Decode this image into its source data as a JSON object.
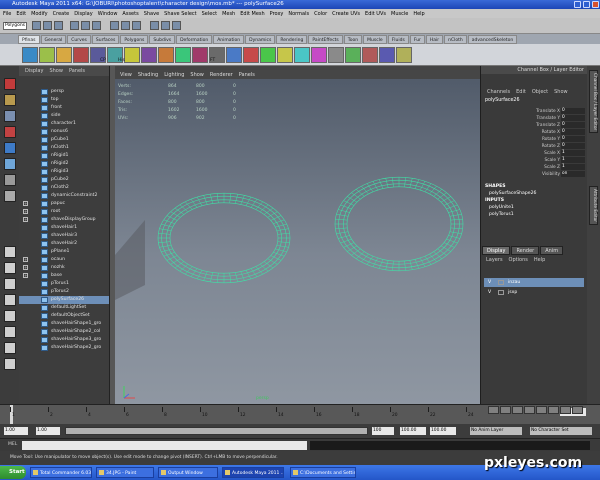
{
  "window": {
    "title": "Autodesk Maya 2011 x64: G:\\JOBURI\\photoshoptalent\\character design\\mos.mb* --- polySurface26"
  },
  "menubar": [
    "File",
    "Edit",
    "Modify",
    "Create",
    "Display",
    "Window",
    "Assets",
    "Shave",
    "Shave Select",
    "Select",
    "Mesh",
    "Edit Mesh",
    "Proxy",
    "Normals",
    "Color",
    "Create UVs",
    "Edit UVs",
    "Muscle",
    "Help"
  ],
  "statusline": {
    "mode": "Polygons"
  },
  "shelf_tabs": [
    "Pfinas",
    "General",
    "Curves",
    "Surfaces",
    "Polygons",
    "Subdivs",
    "Deformation",
    "Animation",
    "Dynamics",
    "Rendering",
    "PaintEffects",
    "Toon",
    "Muscle",
    "Fluids",
    "Fur",
    "Hair",
    "nCloth",
    "advancedSkeleton"
  ],
  "shelf_labels": [
    "CP",
    "His",
    "FT"
  ],
  "outliner": {
    "menu": [
      "Display",
      "Show",
      "Panels"
    ],
    "items": [
      {
        "label": "persp",
        "expandable": false,
        "selected": false
      },
      {
        "label": "top",
        "expandable": false,
        "selected": false
      },
      {
        "label": "front",
        "expandable": false,
        "selected": false
      },
      {
        "label": "side",
        "expandable": false,
        "selected": false
      },
      {
        "label": "character1",
        "expandable": false,
        "selected": false
      },
      {
        "label": "nonus6",
        "expandable": false,
        "selected": false
      },
      {
        "label": "pCube1",
        "expandable": false,
        "selected": false
      },
      {
        "label": "nCloth1",
        "expandable": false,
        "selected": false
      },
      {
        "label": "nRigid1",
        "expandable": false,
        "selected": false
      },
      {
        "label": "nRigid2",
        "expandable": false,
        "selected": false
      },
      {
        "label": "nRigid3",
        "expandable": false,
        "selected": false
      },
      {
        "label": "pCube2",
        "expandable": false,
        "selected": false
      },
      {
        "label": "nCloth2",
        "expandable": false,
        "selected": false
      },
      {
        "label": "dynamicConstraint2",
        "expandable": false,
        "selected": false
      },
      {
        "label": "papuc",
        "expandable": true,
        "selected": false
      },
      {
        "label": "root",
        "expandable": true,
        "selected": false
      },
      {
        "label": "shaveDisplayGroup",
        "expandable": true,
        "selected": false
      },
      {
        "label": "shaveHair1",
        "expandable": false,
        "selected": false
      },
      {
        "label": "shaveHair3",
        "expandable": false,
        "selected": false
      },
      {
        "label": "shaveHair2",
        "expandable": false,
        "selected": false
      },
      {
        "label": "pPlane1",
        "expandable": false,
        "selected": false
      },
      {
        "label": "ocaun",
        "expandable": true,
        "selected": false
      },
      {
        "label": "nozhk",
        "expandable": true,
        "selected": false
      },
      {
        "label": "base",
        "expandable": true,
        "selected": false
      },
      {
        "label": "pTorus1",
        "expandable": false,
        "selected": false
      },
      {
        "label": "pTorus2",
        "expandable": false,
        "selected": false
      },
      {
        "label": "polySurface26",
        "expandable": false,
        "selected": true
      },
      {
        "label": "defaultLightSet",
        "expandable": false,
        "selected": false
      },
      {
        "label": "defaultObjectSet",
        "expandable": false,
        "selected": false
      },
      {
        "label": "shaveHairShape1_gro",
        "expandable": false,
        "selected": false
      },
      {
        "label": "shaveHairShape2_col",
        "expandable": false,
        "selected": false
      },
      {
        "label": "shaveHairShape3_gro",
        "expandable": false,
        "selected": false
      },
      {
        "label": "shaveHairShape2_gro",
        "expandable": false,
        "selected": false
      }
    ]
  },
  "viewport": {
    "menu": [
      "View",
      "Shading",
      "Lighting",
      "Show",
      "Renderer",
      "Panels"
    ],
    "camera": "persp",
    "hud": [
      {
        "label": "Verts:",
        "v1": "864",
        "v2": "800",
        "v3": "0"
      },
      {
        "label": "Edges:",
        "v1": "1664",
        "v2": "1600",
        "v3": "0"
      },
      {
        "label": "Faces:",
        "v1": "800",
        "v2": "800",
        "v3": "0"
      },
      {
        "label": "Tris:",
        "v1": "1602",
        "v2": "1600",
        "v3": "0"
      },
      {
        "label": "UVs:",
        "v1": "906",
        "v2": "902",
        "v3": "0"
      }
    ],
    "wire_color": "#3fe0a6"
  },
  "channel_box": {
    "header": "Channel Box / Layer Editor",
    "menu": [
      "Channels",
      "Edit",
      "Object",
      "Show"
    ],
    "object": "polySurface26",
    "attributes": [
      {
        "name": "Translate X",
        "value": "0"
      },
      {
        "name": "Translate Y",
        "value": "0"
      },
      {
        "name": "Translate Z",
        "value": "0"
      },
      {
        "name": "Rotate X",
        "value": "0"
      },
      {
        "name": "Rotate Y",
        "value": "0"
      },
      {
        "name": "Rotate Z",
        "value": "0"
      },
      {
        "name": "Scale X",
        "value": "1"
      },
      {
        "name": "Scale Y",
        "value": "1"
      },
      {
        "name": "Scale Z",
        "value": "1"
      },
      {
        "name": "Visibility",
        "value": "on"
      }
    ],
    "shapes_label": "SHAPES",
    "shape": "polySurfaceShape26",
    "inputs_label": "INPUTS",
    "inputs": [
      "polyUnite1",
      "polyTorus1"
    ]
  },
  "layer_editor": {
    "tabs": [
      "Display",
      "Render",
      "Anim"
    ],
    "menu": [
      "Layers",
      "Options",
      "Help"
    ],
    "layers": [
      {
        "v": "V",
        "name": "inzau",
        "selected": true
      },
      {
        "v": "V",
        "name": "jsxp",
        "selected": false
      }
    ]
  },
  "side_tabs": [
    "Channel Box / Layer Editor",
    "Attribute Editor"
  ],
  "timeslider": {
    "ticks": [
      "1",
      "2",
      "4",
      "6",
      "8",
      "10",
      "12",
      "14",
      "16",
      "18",
      "20",
      "22",
      "24"
    ],
    "current": "1.00"
  },
  "range": {
    "start": "1.00",
    "inner_start": "1.00",
    "inner_end": "100",
    "end": "100.00",
    "end2": "100.00",
    "anim_layer": "No Anim Layer",
    "char_set": "No Character Set"
  },
  "cmdline": {
    "label": "MEL"
  },
  "helpline": "Move Tool: Use manipulator to move object(s). Use edit mode to change pivot (INSERT). Ctrl+LMB to move perpendicular.",
  "taskbar": {
    "start": "Start",
    "tasks": [
      {
        "label": "Total Commander 6.03 - ...",
        "active": false
      },
      {
        "label": "34.JPG - Paint",
        "active": false
      },
      {
        "label": "Output Window",
        "active": false
      },
      {
        "label": "Autodesk Maya 2011 ...",
        "active": true
      },
      {
        "label": "C:\\Documents and Settin...",
        "active": false
      }
    ]
  },
  "watermark": "pxleyes.com"
}
